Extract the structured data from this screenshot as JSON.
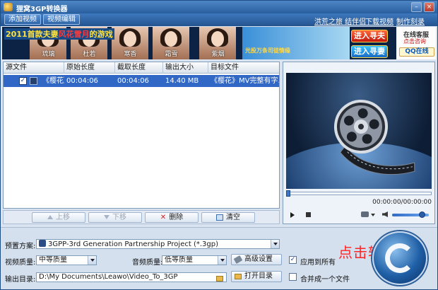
{
  "window": {
    "title": "狸窝3GP转换器"
  },
  "toolbar": {
    "add_video": "添加视频",
    "edit_video": "视频编辑",
    "links": [
      "洪荒之旅 结伴侣",
      "下载视频",
      "制作刻录DVD"
    ]
  },
  "banner": {
    "caption_prefix": "2011首款",
    "caption_mid": "夫妻",
    "caption_highlight": "风花雪月",
    "caption_suffix": "的游戏",
    "thumb_names": [
      "琉璃",
      "杜若",
      "寒香",
      "霜雪",
      "紫烟"
    ],
    "game_text": "光投万条司徒情缘",
    "find_husband": "进入寻夫",
    "find_wife": "进入寻妻",
    "online_service": "在线客服",
    "click_consult": "点击咨询",
    "qq_online": "QQ在线"
  },
  "file_list": {
    "columns": [
      "源文件",
      "原始长度",
      "截取长度",
      "输出大小",
      "目标文件"
    ],
    "rows": [
      {
        "checked": "✓",
        "source": "《樱花》...",
        "original_length": "00:04:06",
        "clip_length": "00:04:06",
        "output_size": "14.40 MB",
        "target": "《樱花》MV完整有字..."
      }
    ]
  },
  "list_actions": {
    "move_up": "上移",
    "move_down": "下移",
    "delete": "删除",
    "clear": "清空"
  },
  "preview": {
    "timecode": "00:00:00/00:00:00",
    "seek_progress": 0,
    "volume_level": 0.85
  },
  "settings": {
    "preset_label": "预置方案:",
    "preset_value": "3GPP-3rd Generation Partnership Project (*.3gp)",
    "video_quality_label": "视频质量:",
    "video_quality_value": "中等质量",
    "audio_quality_label": "音频质量:",
    "audio_quality_value": "低等质量",
    "advanced": "高级设置",
    "apply_all": "应用到所有",
    "apply_all_checked": "✓",
    "output_dir_label": "输出目录:",
    "output_dir_value": "D:\\My Documents\\Leawo\\Video_To_3GP",
    "open_dir": "打开目录",
    "merge_label": "合并成一个文件",
    "convert_hint": "点击转换!"
  },
  "colors": {
    "accent": "#3168c6",
    "title_bar": "#2a5f9e",
    "hint_red": "#ff2424"
  }
}
